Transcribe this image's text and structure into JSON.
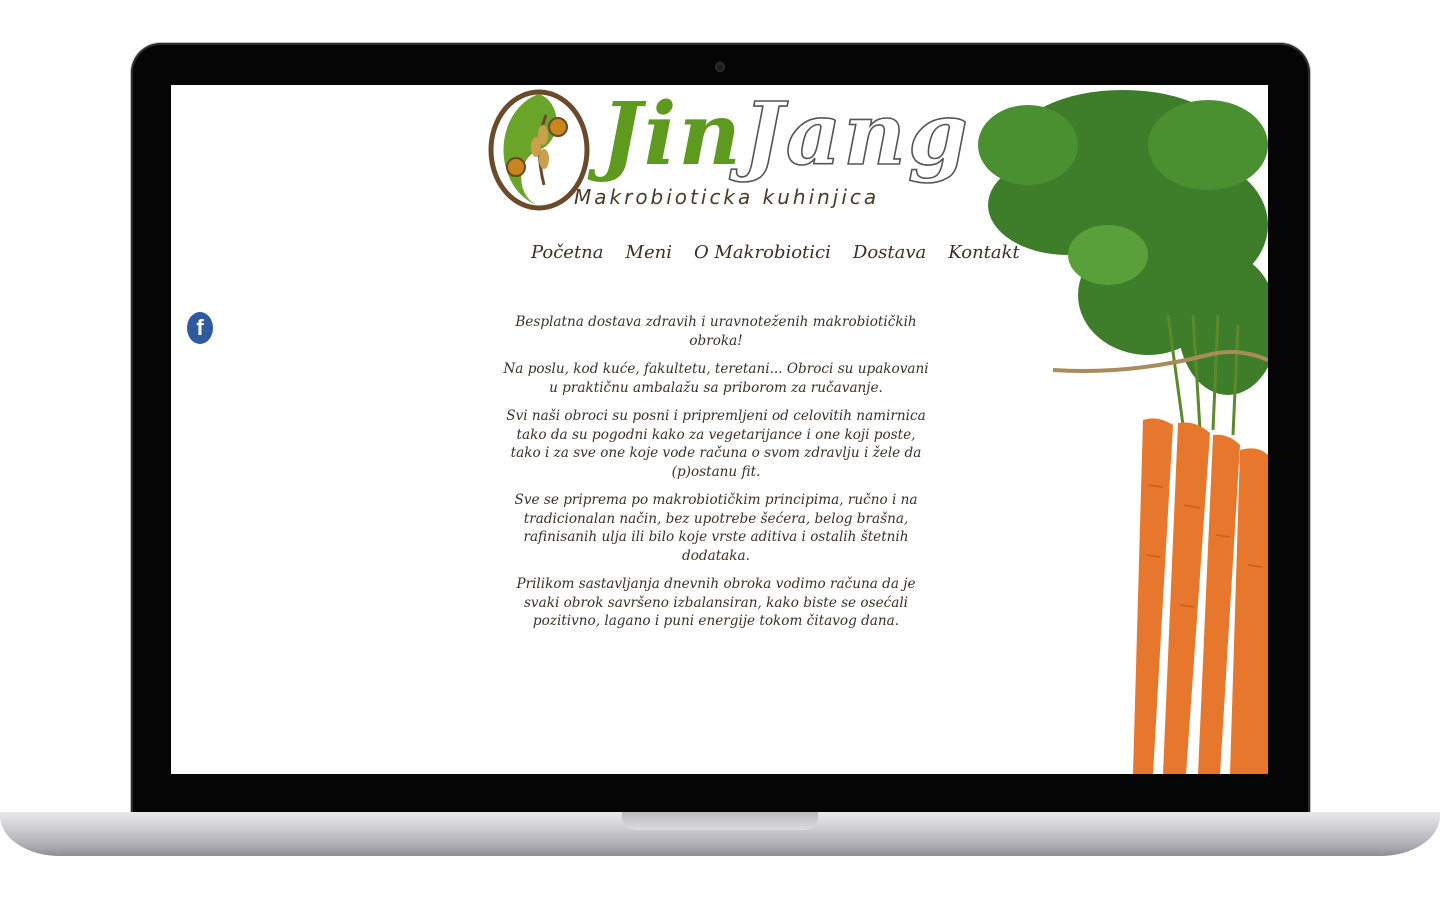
{
  "logo": {
    "word_left": "Jin",
    "word_right": "Jang",
    "tagline": "Makrobioticka kuhinjica"
  },
  "nav": {
    "items": [
      "Početna",
      "Meni",
      "O Makrobiotici",
      "Dostava",
      "Kontakt"
    ]
  },
  "social": {
    "facebook_glyph": "f",
    "icon": "facebook-icon"
  },
  "content": {
    "paragraphs": [
      "Besplatna dostava zdravih i uravnoteženih makrobiotičkih obroka!",
      "Na poslu, kod kuće, fakultetu, teretani... Obroci su upakovani u praktičnu ambalažu sa priborom za ručavanje.",
      "Svi naši obroci su posni i pripremljeni od celovitih namirnica tako da su pogodni kako za vegetarijance i one koji poste, tako i za sve one koje vode računa o svom zdravlju i žele da (p)ostanu fit.",
      "Sve se priprema po makrobiotičkim principima, ručno i na tradicionalan način, bez upotrebe šećera, belog brašna, rafinisanih ulja ili bilo koje vrste aditiva i ostalih štetnih dodataka.",
      "Prilikom sastavljanja dnevnih obroka vodimo računa da je svaki obrok savršeno izbalansiran, kako biste se osećali pozitivno, lagano i puni energije tokom čitavog dana."
    ]
  },
  "colors": {
    "brand_green": "#5e9a1d",
    "text_brown": "#3b3025",
    "facebook_blue": "#2f5aa0",
    "carrot_orange": "#e8772e",
    "leaf_green": "#3e7d2a"
  }
}
